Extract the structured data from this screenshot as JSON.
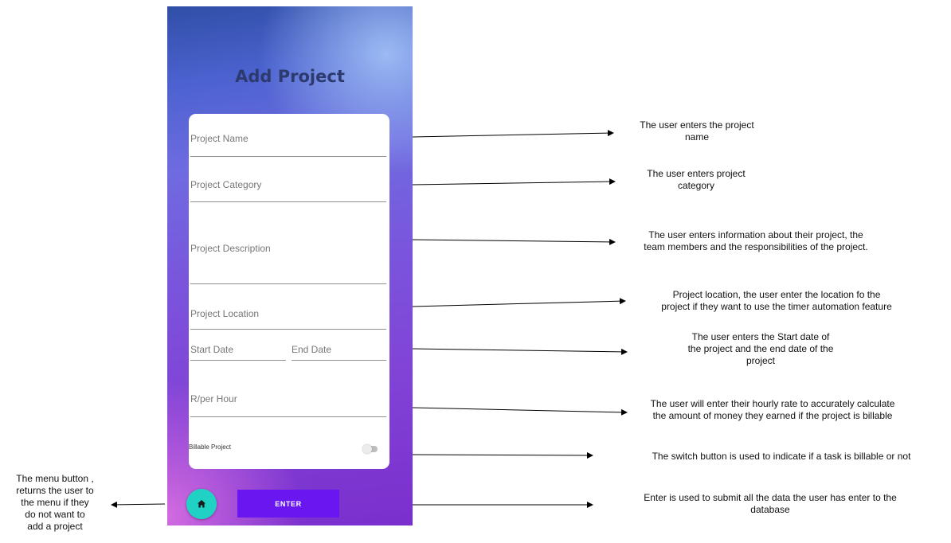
{
  "screen": {
    "title": "Add Project",
    "fields": [
      {
        "label": "Project Name"
      },
      {
        "label": "Project Category"
      },
      {
        "label": "Project Description"
      },
      {
        "label": "Project Location"
      },
      {
        "label": "Start Date"
      },
      {
        "label": "End Date"
      },
      {
        "label": "R/per Hour"
      }
    ],
    "billable_label": "Billable Project",
    "billable_on": false,
    "enter_label": "ENTER",
    "home_icon": "home-icon"
  },
  "annotations": {
    "project_name": [
      "The user enters the project",
      "name"
    ],
    "project_category": [
      "The user enters project",
      "category"
    ],
    "project_description": [
      "The user enters information about their project, the",
      "team members and the responsibilities of the project."
    ],
    "project_location": [
      "Project location, the user enter the location fo the",
      "project if they want to use the timer automation feature"
    ],
    "dates": [
      "The user enters the Start date of",
      "the project and the end date of the",
      "project"
    ],
    "rate": [
      "The user will enter their hourly rate to accurately calculate",
      "the amount of money they earned if the project is billable"
    ],
    "billable": [
      "The switch button is used to indicate if a task is billable or not"
    ],
    "enter": [
      "Enter is used to submit all the data the user has enter to the",
      "database"
    ],
    "menu": [
      "The menu button ,",
      "returns the user to",
      "the menu if they",
      "do not want to",
      "add a project"
    ]
  }
}
